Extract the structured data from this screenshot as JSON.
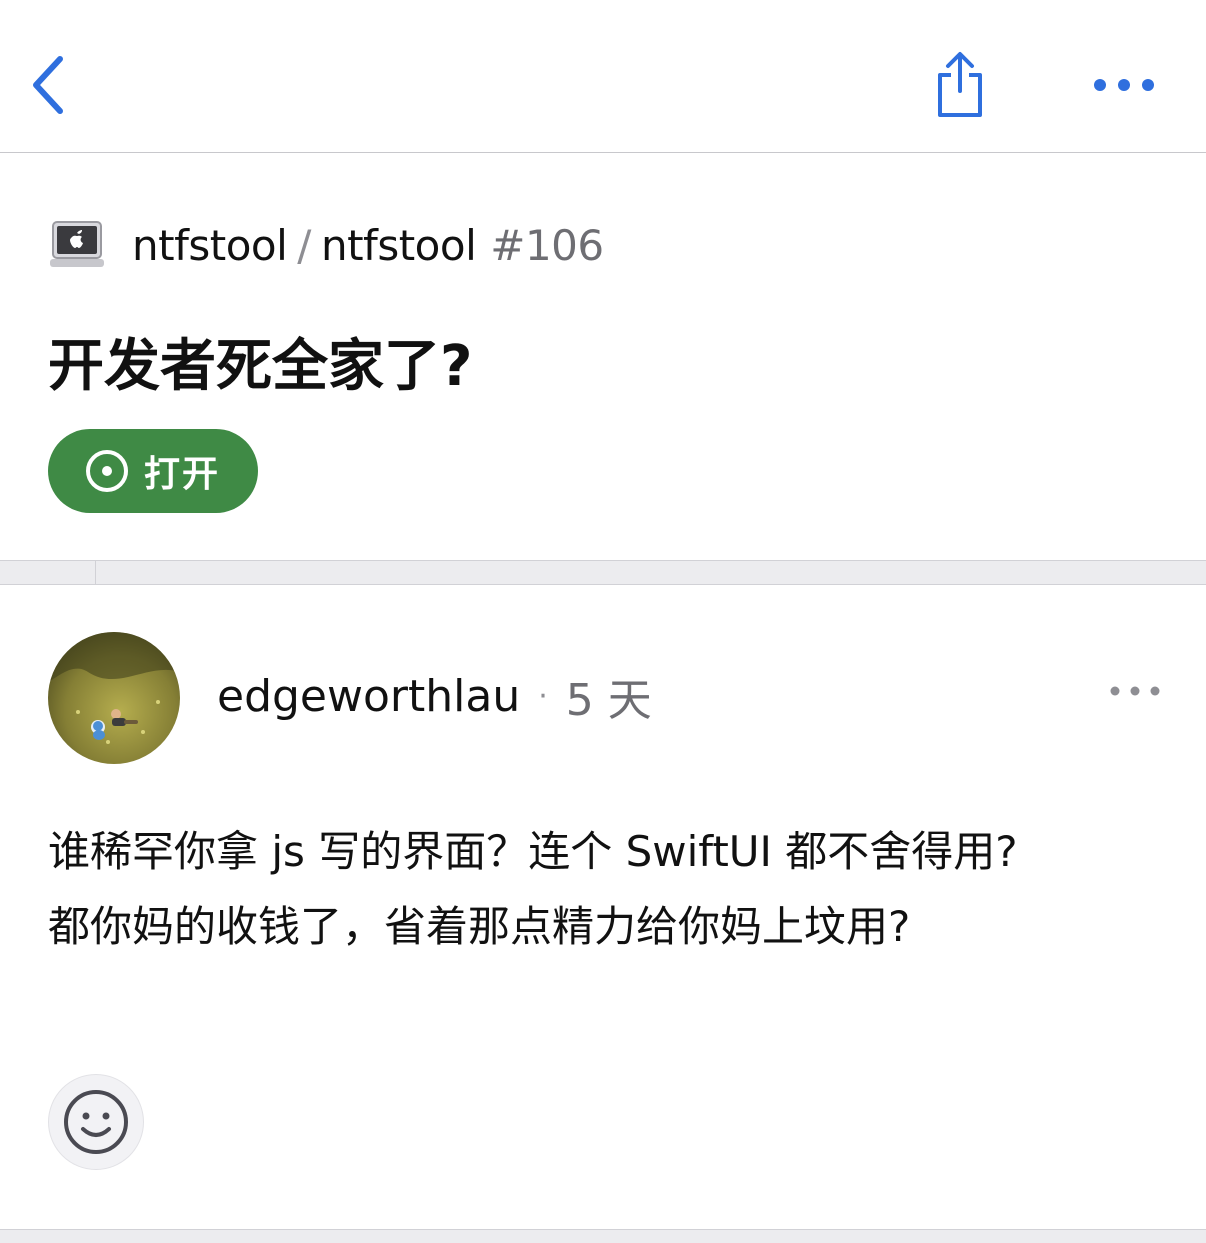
{
  "colors": {
    "accent": "#2f6fde",
    "open_state": "#3f8a45",
    "secondary_text": "#6e6e73"
  },
  "nav": {
    "back_icon": "chevron-left-icon",
    "share_icon": "share-icon",
    "more_icon": "ellipsis-icon"
  },
  "issue": {
    "repo_owner": "ntfstool",
    "repo_separator": "/",
    "repo_name": "ntfstool",
    "number": "#106",
    "title": "开发者死全家了?",
    "state": {
      "label": "打开",
      "icon": "issue-open-icon"
    }
  },
  "comment": {
    "author": "edgeworthlau",
    "separator": "·",
    "time": "5 天",
    "more_icon": "ellipsis-icon",
    "body_lines": [
      "谁稀罕你拿 js 写的界面？连个 SwiftUI 都不舍得用?",
      "都你妈的收钱了，省着那点精力给你妈上坟用?"
    ],
    "reaction_icon": "smiley-icon"
  }
}
